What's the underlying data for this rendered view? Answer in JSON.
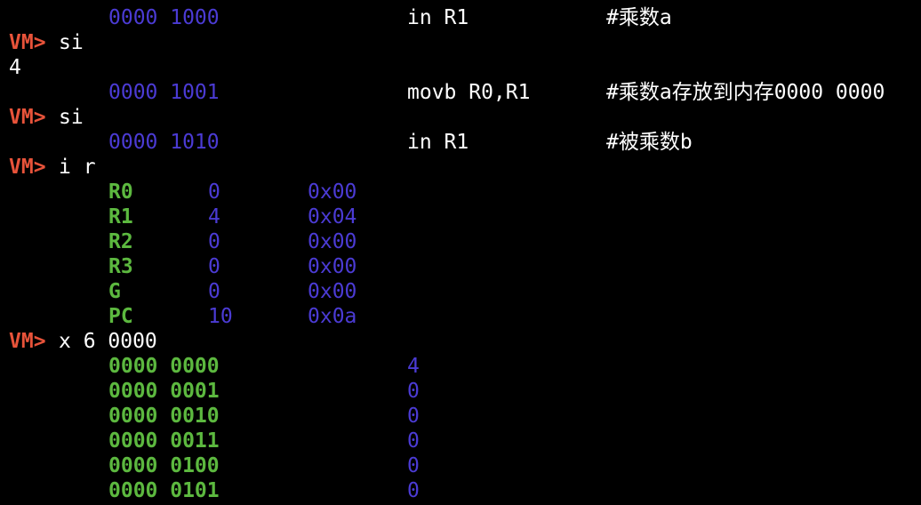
{
  "prompt": "VM>",
  "lines": {
    "l1": {
      "addr": "0000 1000",
      "instr": "in R1",
      "comment": "#乘数a"
    },
    "l2": {
      "cmd": "si"
    },
    "l3": {
      "output": "4"
    },
    "l4": {
      "addr": "0000 1001",
      "instr": "movb R0,R1",
      "comment": "#乘数a存放到内存0000 0000"
    },
    "l5": {
      "cmd": "si"
    },
    "l6": {
      "addr": "0000 1010",
      "instr": "in R1",
      "comment": "#被乘数b"
    },
    "l7": {
      "cmd": "i r"
    }
  },
  "registers": [
    {
      "name": "R0",
      "dec": "0",
      "hex": "0x00"
    },
    {
      "name": "R1",
      "dec": "4",
      "hex": "0x04"
    },
    {
      "name": "R2",
      "dec": "0",
      "hex": "0x00"
    },
    {
      "name": "R3",
      "dec": "0",
      "hex": "0x00"
    },
    {
      "name": "G",
      "dec": "0",
      "hex": "0x00"
    },
    {
      "name": "PC",
      "dec": "10",
      "hex": "0x0a"
    }
  ],
  "mem_cmd": "x 6 0000",
  "memory": [
    {
      "addr": "0000 0000",
      "val": "4"
    },
    {
      "addr": "0000 0001",
      "val": "0"
    },
    {
      "addr": "0000 0010",
      "val": "0"
    },
    {
      "addr": "0000 0011",
      "val": "0"
    },
    {
      "addr": "0000 0100",
      "val": "0"
    },
    {
      "addr": "0000 0101",
      "val": "0"
    }
  ],
  "colors": {
    "prompt": "#e8533a",
    "address": "#4b3bd4",
    "label": "#5cb83f"
  }
}
